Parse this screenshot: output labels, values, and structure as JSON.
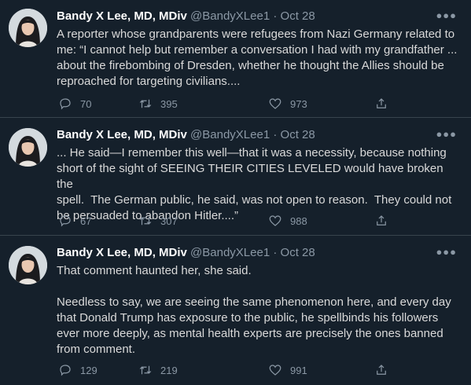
{
  "tweets": [
    {
      "name": "Bandy X Lee, MD, MDiv",
      "handle": "@BandyXLee1",
      "dot": "·",
      "date": "Oct 28",
      "text": "A reporter whose grandparents were refugees from Nazi Germany related to\nme: “I cannot help but remember a conversation I had with my grandfather ...\nabout the firebombing of Dresden, whether he thought the Allies should be\nreproached for targeting civilians....",
      "replies": "70",
      "retweets": "395",
      "likes": "973"
    },
    {
      "name": "Bandy X Lee, MD, MDiv",
      "handle": "@BandyXLee1",
      "dot": "·",
      "date": "Oct 28",
      "text": "... He said—I remember this well—that it was a necessity, because nothing\nshort of the sight of SEEING THEIR CITIES LEVELED would have broken the\nspell.  The German public, he said, was not open to reason.  They could not\nbe persuaded to abandon Hitler....”",
      "replies": "67",
      "retweets": "307",
      "likes": "988"
    },
    {
      "name": "Bandy X Lee, MD, MDiv",
      "handle": "@BandyXLee1",
      "dot": "·",
      "date": "Oct 28",
      "text": "That comment haunted her, she said.\n\nNeedless to say, we are seeing the same phenomenon here, and every day\nthat Donald Trump has exposure to the public, he spellbinds his followers\never more deeply, as mental health experts are precisely the ones banned\nfrom comment.",
      "replies": "129",
      "retweets": "219",
      "likes": "991"
    }
  ],
  "icons": {
    "more": "more-icon",
    "reply": "reply-icon",
    "retweet": "retweet-icon",
    "like": "heart-icon",
    "share": "share-icon"
  },
  "colors": {
    "background": "#15202b",
    "divider": "#38444d",
    "name": "#ffffff",
    "secondary": "#8b98a5",
    "text": "#d9d9d9"
  }
}
